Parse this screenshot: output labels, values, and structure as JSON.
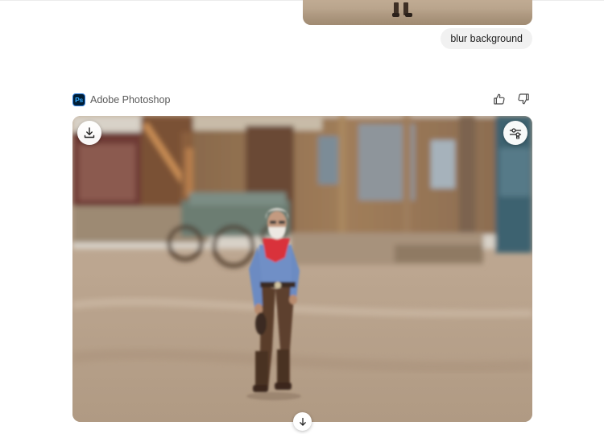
{
  "conversation": {
    "previous_image": {
      "icon": "photo-thumbnail"
    },
    "user_message": {
      "text": "blur background"
    },
    "assistant": {
      "app_name": "Adobe Photoshop",
      "logo_text": "Ps",
      "logo_colors": {
        "background": "#001e36",
        "accent": "#31a8ff"
      },
      "feedback": {
        "like_icon": "thumbs-up-icon",
        "dislike_icon": "thumbs-down-icon"
      },
      "image": {
        "download_icon": "download-icon",
        "adjust_icon": "adjust-sliders-icon"
      }
    }
  },
  "scroll_down": {
    "icon": "arrow-down-icon"
  }
}
